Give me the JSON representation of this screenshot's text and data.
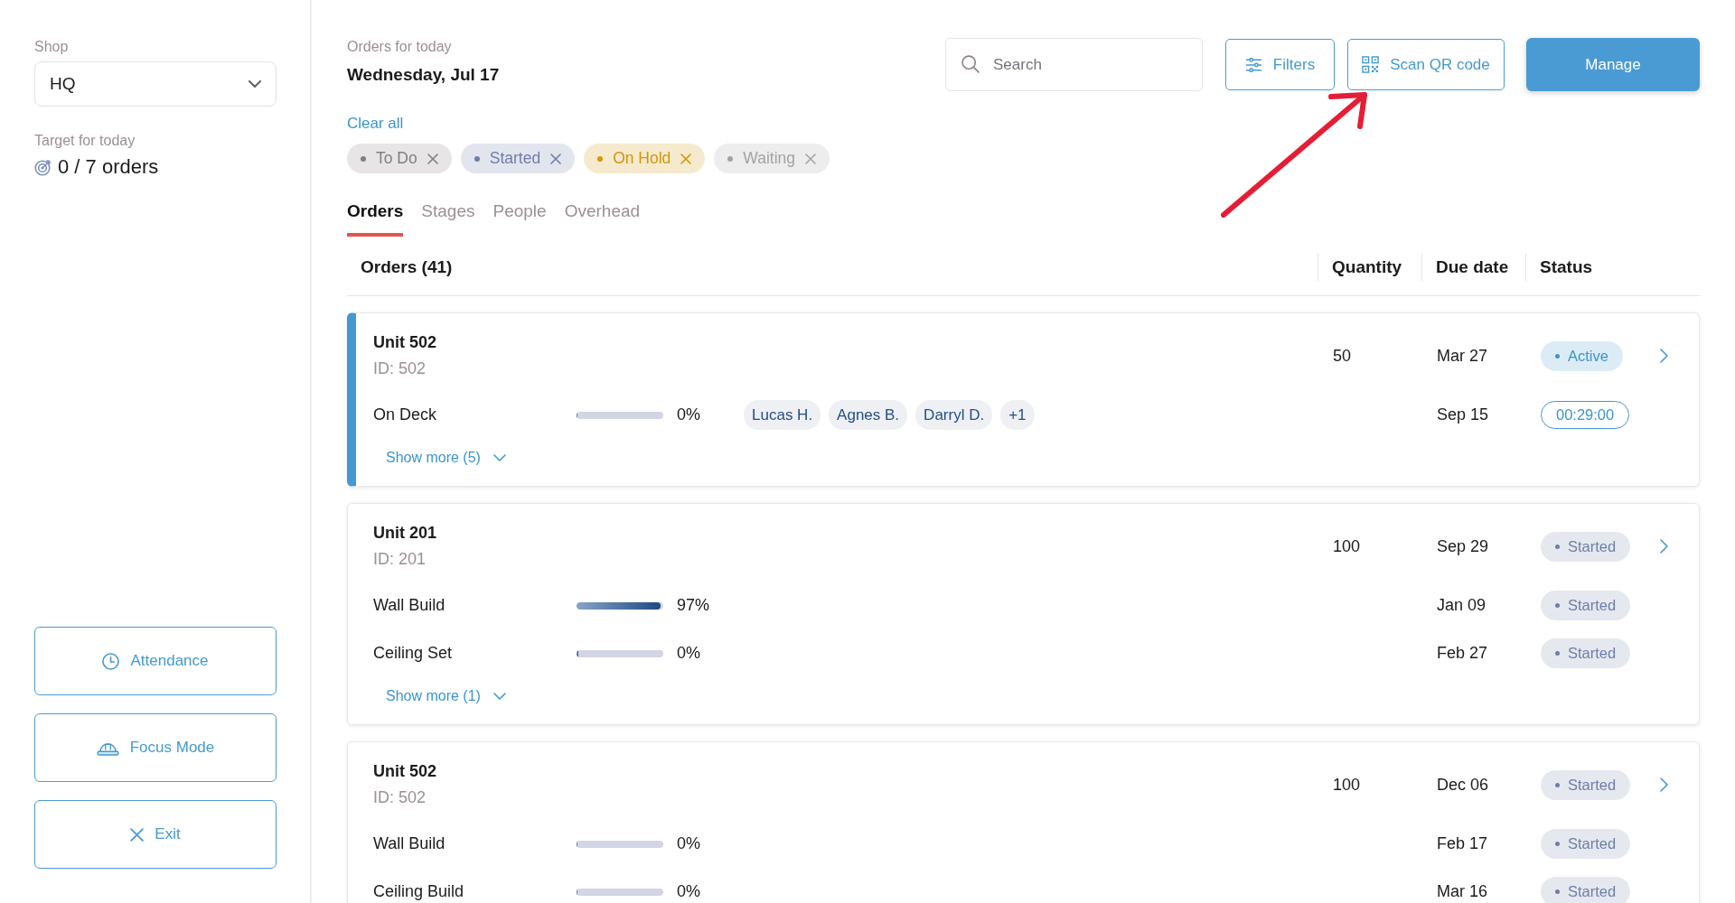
{
  "sidebar": {
    "shop": {
      "label": "Shop",
      "value": "HQ"
    },
    "target": {
      "label": "Target for today",
      "value": "0 / 7 orders"
    },
    "actions": [
      {
        "kind": "clock",
        "label": "Attendance"
      },
      {
        "kind": "helmet",
        "label": "Focus Mode"
      },
      {
        "kind": "close",
        "label": "Exit"
      }
    ]
  },
  "header": {
    "subtitle": "Orders for today",
    "date": "Wednesday, Jul 17",
    "search": {
      "placeholder": "Search"
    },
    "buttons": [
      {
        "kind": "filters",
        "label": "Filters"
      },
      {
        "kind": "qr",
        "label": "Scan QR code"
      },
      {
        "kind": "primary",
        "label": "Manage"
      }
    ]
  },
  "filters": {
    "clear": "Clear all",
    "chips": [
      {
        "label": "To Do",
        "color": "#857d80"
      },
      {
        "label": "Started",
        "color": "#6f7ea8"
      },
      {
        "label": "On Hold",
        "color": "#d4950a"
      },
      {
        "label": "Waiting",
        "color": "#a3a3a3"
      }
    ]
  },
  "tabs": [
    {
      "label": "Orders",
      "selected": true
    },
    {
      "label": "Stages",
      "selected": false
    },
    {
      "label": "People",
      "selected": false
    },
    {
      "label": "Overhead",
      "selected": false
    }
  ],
  "table": {
    "columns": [
      "Orders (41)",
      "Quantity",
      "Due date",
      "Status"
    ],
    "orders": [
      {
        "name": "Unit 502",
        "id": "ID: 502",
        "quantity": "50",
        "due": "Mar 27",
        "status": {
          "label": "Active",
          "color": "#3b94cf"
        },
        "selected": true,
        "stages": [
          {
            "name": "On Deck",
            "level": 0,
            "percent": "0%",
            "people": [
              "Lucas H.",
              "Agnes B.",
              "Darryl D.",
              "+1"
            ],
            "due": "Sep 15",
            "status": {
              "kind": "timer",
              "label": "00:29:00"
            }
          }
        ],
        "show_more": "Show more (5)"
      },
      {
        "name": "Unit 201",
        "id": "ID: 201",
        "quantity": "100",
        "due": "Sep 29",
        "status": {
          "label": "Started",
          "color": "#6f7ea8"
        },
        "selected": false,
        "stages": [
          {
            "name": "Wall Build",
            "level": 0.97,
            "percent": "97%",
            "due": "Jan 09",
            "status": {
              "kind": "badge",
              "label": "Started",
              "color": "#6f7ea8"
            }
          },
          {
            "name": "Ceiling Set",
            "level": 0.02,
            "percent": "0%",
            "due": "Feb 27",
            "status": {
              "kind": "badge",
              "label": "Started",
              "color": "#6f7ea8"
            }
          }
        ],
        "show_more": "Show more (1)"
      },
      {
        "name": "Unit 502",
        "id": "ID: 502",
        "quantity": "100",
        "due": "Dec 06",
        "status": {
          "label": "Started",
          "color": "#6f7ea8"
        },
        "selected": false,
        "stages": [
          {
            "name": "Wall Build",
            "level": 0,
            "percent": "0%",
            "due": "Feb 17",
            "status": {
              "kind": "badge",
              "label": "Started",
              "color": "#6f7ea8"
            }
          },
          {
            "name": "Ceiling Build",
            "level": 0,
            "percent": "0%",
            "due": "Mar 16",
            "status": {
              "kind": "badge",
              "label": "Started",
              "color": "#6f7ea8"
            }
          }
        ]
      }
    ]
  }
}
